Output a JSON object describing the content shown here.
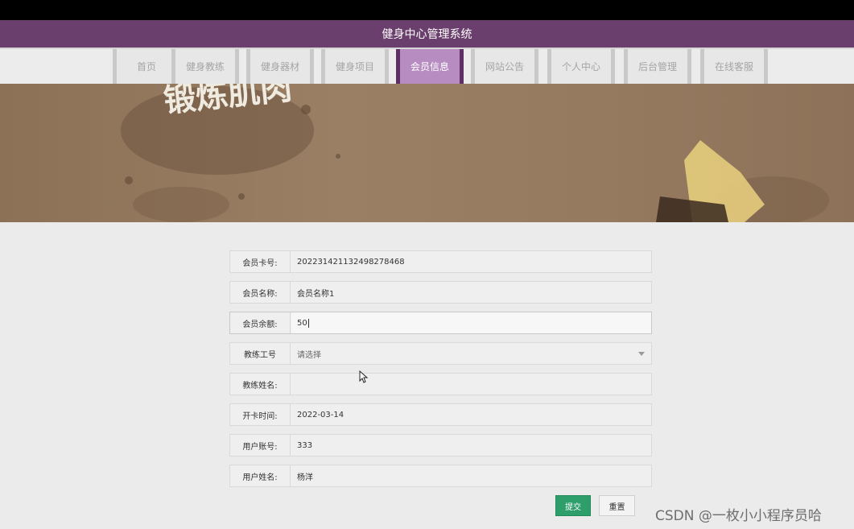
{
  "app": {
    "title": "健身中心管理系统"
  },
  "nav": {
    "items": [
      {
        "label": "首页"
      },
      {
        "label": "健身教练"
      },
      {
        "label": "健身器材"
      },
      {
        "label": "健身项目"
      },
      {
        "label": "会员信息"
      },
      {
        "label": "网站公告"
      },
      {
        "label": "个人中心"
      },
      {
        "label": "后台管理"
      },
      {
        "label": "在线客服"
      }
    ],
    "active": "会员信息"
  },
  "banner": {
    "text": "锻炼肌肉"
  },
  "form": {
    "fields": [
      {
        "label": "会员卡号:",
        "value": "202231421132498278468"
      },
      {
        "label": "会员名称:",
        "value": "会员名称1"
      },
      {
        "label": "会员余额:",
        "value": "50"
      },
      {
        "label": "教练工号",
        "value": "请选择"
      },
      {
        "label": "教练姓名:",
        "value": ""
      },
      {
        "label": "开卡时间:",
        "value": "2022-03-14"
      },
      {
        "label": "用户账号:",
        "value": "333"
      },
      {
        "label": "用户姓名:",
        "value": "杨洋"
      }
    ],
    "submit_label": "提交",
    "reset_label": "重置"
  },
  "watermark": "CSDN @一枚小小程序员哈",
  "colors": {
    "header": "#6b3f6d",
    "nav_active": "#b68cc1",
    "submit": "#2e9e6b",
    "banner": "#9a7f65"
  }
}
